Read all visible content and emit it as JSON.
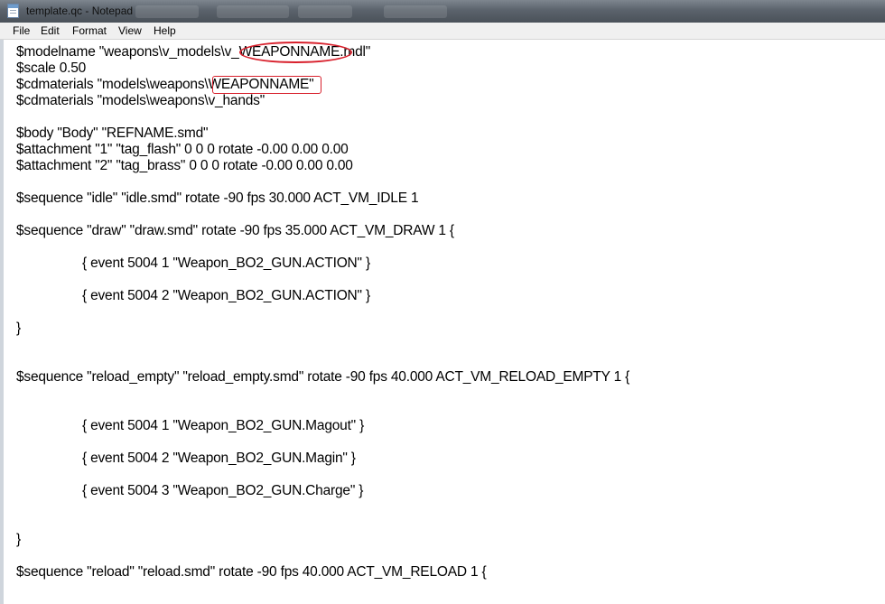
{
  "window": {
    "title": "template.qc - Notepad",
    "icon": "notepad-icon"
  },
  "menu": {
    "items": [
      "File",
      "Edit",
      "Format",
      "View",
      "Help"
    ]
  },
  "editor": {
    "lines": [
      "$modelname \"weapons\\v_models\\v_WEAPONNAME.mdl\"",
      "$scale 0.50",
      "$cdmaterials \"models\\weapons\\WEAPONNAME\"",
      "$cdmaterials \"models\\weapons\\v_hands\"",
      "$body \"Body\" \"REFNAME.smd\"",
      "$attachment \"1\" \"tag_flash\" 0 0 0 rotate -0.00 0.00 0.00",
      "$attachment \"2\" \"tag_brass\" 0 0 0 rotate -0.00 0.00 0.00",
      "$sequence \"idle\" \"idle.smd\" rotate -90 fps 30.000 ACT_VM_IDLE 1",
      "$sequence \"draw\" \"draw.smd\" rotate -90 fps 35.000 ACT_VM_DRAW 1 {",
      "{ event 5004 1 \"Weapon_BO2_GUN.ACTION\" }",
      "{ event 5004 2 \"Weapon_BO2_GUN.ACTION\" }",
      "}",
      "$sequence \"reload_empty\" \"reload_empty.smd\" rotate -90 fps 40.000 ACT_VM_RELOAD_EMPTY 1 {",
      "{ event 5004 1 \"Weapon_BO2_GUN.Magout\" }",
      "{ event 5004 2 \"Weapon_BO2_GUN.Magin\" }",
      "{ event 5004 3 \"Weapon_BO2_GUN.Charge\" }",
      "}",
      "$sequence \"reload\" \"reload.smd\" rotate -90 fps 40.000 ACT_VM_RELOAD 1 {"
    ]
  },
  "annotation_color": "#d8202c"
}
